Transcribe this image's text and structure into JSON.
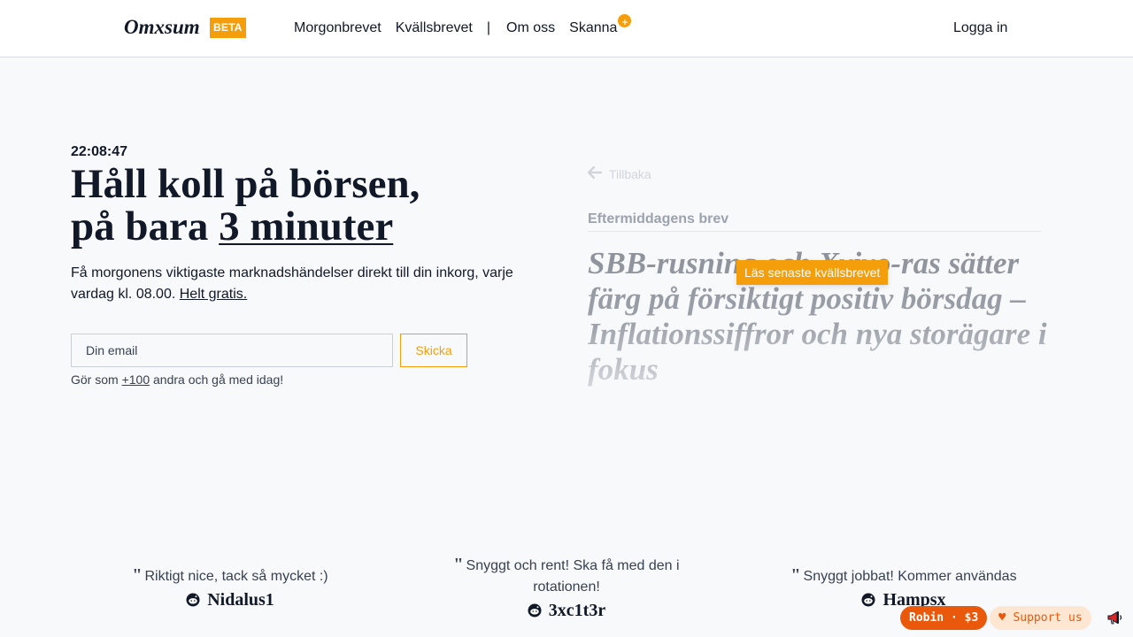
{
  "header": {
    "logo": "Omxsum",
    "badge": "BETA",
    "nav": [
      "Morgonbrevet",
      "Kvällsbrevet",
      "|",
      "Om oss",
      "Skanna"
    ],
    "scan_badge": "+",
    "login": "Logga in"
  },
  "hero": {
    "time": "22:08:47",
    "title_line1": "Håll koll på börsen,",
    "title_line2_prefix": "på bara ",
    "title_line2_highlight": "3 minuter",
    "lead_text": "Få morgonens viktigaste marknadshändelser direkt till din inkorg, varje vardag kl. 08.00. ",
    "lead_link": "Helt gratis.",
    "email_placeholder": "Din email",
    "send_label": "Skicka",
    "social_prefix": "Gör som ",
    "social_link": "+100",
    "social_suffix": " andra och gå med idag!"
  },
  "preview": {
    "back_label": "Tillbaka",
    "label": "Eftermiddagens brev",
    "title": "SBB-rusning och Xvivo-ras sätter färg på försiktigt positiv börsdag – Inflationssiffror och nya storägare i fokus",
    "read_button": "Läs senaste kvällsbrevet"
  },
  "testimonials": [
    {
      "quote": "Riktigt nice, tack så mycket :)",
      "author": "Nidalus1"
    },
    {
      "quote": "Snyggt och rent! Ska få med den i rotationen!",
      "author": "3xc1t3r"
    },
    {
      "quote": "Snyggt jobbat! Kommer användas",
      "author": "Hampsx"
    }
  ],
  "widgets": {
    "robin_label": "Robin · $3",
    "support_label": "Support us"
  },
  "colors": {
    "accent": "#f59e0b",
    "widget_orange": "#ea580c",
    "text": "#111827"
  }
}
